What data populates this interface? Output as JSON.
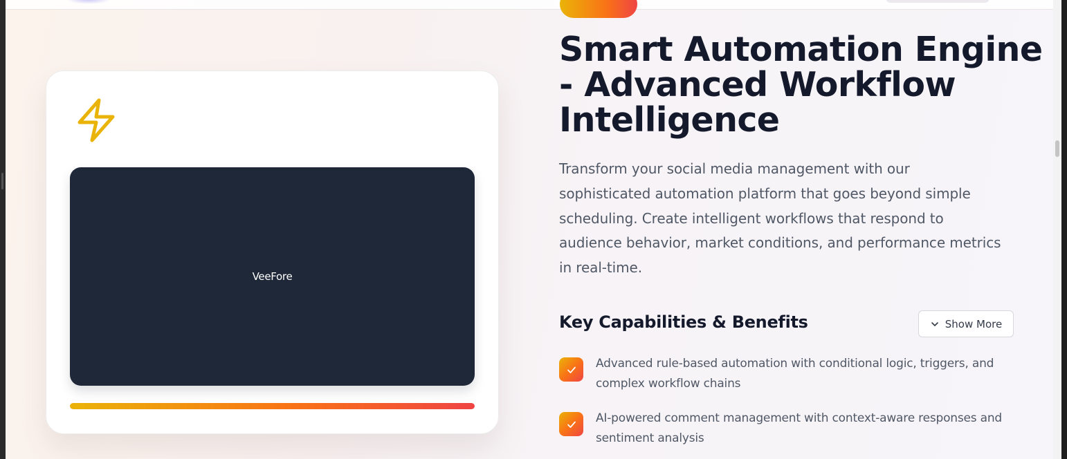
{
  "feature": {
    "badge_text": "",
    "title": "Smart Automation Engine - Advanced Workflow Intelligence",
    "description": "Transform your social media management with our sophisticated automation platform that goes beyond simple scheduling. Create intelligent workflows that respond to audience behavior, market conditions, and performance metrics in real-time.",
    "icon": "lightning-bolt-icon",
    "accent_gradient": [
      "#eab308",
      "#f97316",
      "#ef4444"
    ]
  },
  "preview": {
    "label": "VeeFore",
    "background": "#1f2839",
    "progress": 1.0
  },
  "capabilities": {
    "heading": "Key Capabilities & Benefits",
    "toggle_label": "Show More",
    "items": [
      {
        "text": "Advanced rule-based automation with conditional logic, triggers, and complex workflow chains"
      },
      {
        "text": "AI-powered comment management with context-aware responses and sentiment analysis"
      }
    ]
  }
}
